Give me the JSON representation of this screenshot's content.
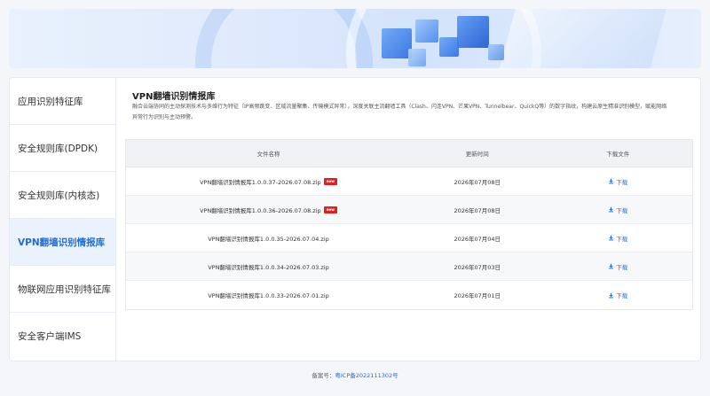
{
  "sidebar": {
    "items": [
      {
        "label": "应用识别特征库",
        "active": false
      },
      {
        "label": "安全规则库(DPDK)",
        "active": false
      },
      {
        "label": "安全规则库(内核态)",
        "active": false
      },
      {
        "label": "VPN翻墙识别情报库",
        "active": true
      },
      {
        "label": "物联网应用识别特征库",
        "active": false
      },
      {
        "label": "安全客户端IMS",
        "active": false
      }
    ]
  },
  "main": {
    "title": "VPN翻墙识别情报库",
    "description": "融合云端协同的主动探测技术与多维行为特征（IP高频跳变、区域流量聚集、传输模式异常），深度关联主流翻墙工具（Clash、闪连VPN、芒果VPN、Tunnelbear、QuickQ等）的数字指纹，构建云原生精准识别模型，赋能网络异常行为识别与主动预警。",
    "table": {
      "headers": [
        "文件名称",
        "更新时间",
        "下载文件"
      ],
      "rows": [
        {
          "name": "VPN翻墙识别情报库1.0.0.37-2026.07.08.zip",
          "date": "2026年07月08日",
          "download": "下载",
          "is_new": true
        },
        {
          "name": "VPN翻墙识别情报库1.0.0.36-2026.07.08.zip",
          "date": "2026年07月08日",
          "download": "下载",
          "is_new": true
        },
        {
          "name": "VPN翻墙识别情报库1.0.0.35-2026.07.04.zip",
          "date": "2026年07月04日",
          "download": "下载",
          "is_new": false
        },
        {
          "name": "VPN翻墙识别情报库1.0.0.34-2026.07.03.zip",
          "date": "2026年07月03日",
          "download": "下载",
          "is_new": false
        },
        {
          "name": "VPN翻墙识别情报库1.0.0.33-2026.07.01.zip",
          "date": "2026年07月01日",
          "download": "下载",
          "is_new": false
        }
      ],
      "new_badge": "new"
    }
  },
  "footer": {
    "label": "备案号：",
    "icp": "粤ICP备2022111302号"
  },
  "colors": {
    "accent": "#1f6ddc",
    "active_bg": "#eaf2fd",
    "badge": "#e02020"
  },
  "icons": {
    "download": "download-icon"
  }
}
